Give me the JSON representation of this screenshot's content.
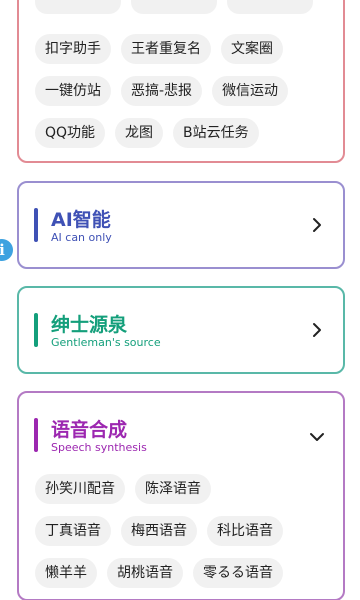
{
  "tools_card": {
    "rows": [
      [
        "扣字助手",
        "王者重复名",
        "文案圈"
      ],
      [
        "一键仿站",
        "恶搞-悲报",
        "微信运动"
      ],
      [
        "QQ功能",
        "龙图",
        "B站云任务"
      ]
    ]
  },
  "ai_card": {
    "title": "AI智能",
    "subtitle": "AI can only",
    "accent": "#3f51b5"
  },
  "gentleman_card": {
    "title": "绅士源泉",
    "subtitle": "Gentleman's source",
    "accent": "#149f7b"
  },
  "speech_card": {
    "title": "语音合成",
    "subtitle": "Speech synthesis",
    "accent": "#9c27b0",
    "rows": [
      [
        "孙笑川配音",
        "陈泽语音"
      ],
      [
        "丁真语音",
        "梅西语音",
        "科比语音"
      ],
      [
        "懒羊羊",
        "胡桃语音",
        "零るる语音"
      ]
    ]
  },
  "colors": {
    "tools_border": "#e28b94",
    "ai_border": "#9a8fd0",
    "gentleman_border": "#59b8a8",
    "speech_border": "#b47ac4",
    "info_icon": "#3ea2e0"
  },
  "icons": {
    "ai_chevron": "chevron-right-icon",
    "gentleman_chevron": "chevron-right-icon",
    "speech_chevron": "chevron-down-icon",
    "floating": "info-icon"
  }
}
